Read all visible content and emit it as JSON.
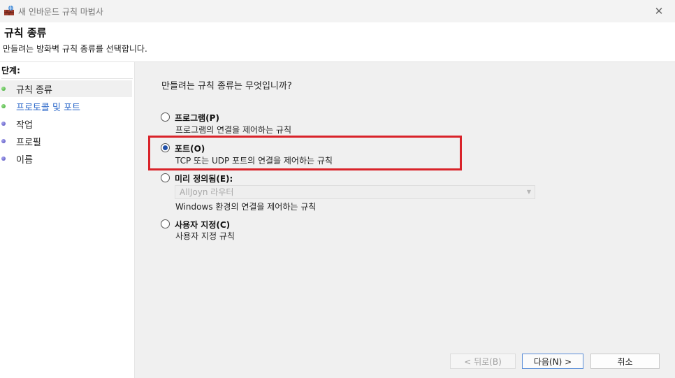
{
  "window": {
    "title": "새 인바운드 규칙 마법사",
    "close_glyph": "✕"
  },
  "header": {
    "title": "규칙 종류",
    "description": "만들려는 방화벽 규칙 종류를 선택합니다."
  },
  "sidebar": {
    "heading": "단계:",
    "steps": [
      {
        "label": "규칙 종류",
        "status": "completed-current"
      },
      {
        "label": "프로토콜 및 포트",
        "status": "completed-link"
      },
      {
        "label": "작업",
        "status": "pending"
      },
      {
        "label": "프로필",
        "status": "pending"
      },
      {
        "label": "이름",
        "status": "pending"
      }
    ]
  },
  "main": {
    "question": "만들려는 규칙 종류는 무엇입니까?",
    "options": [
      {
        "label": "프로그램(P)",
        "description": "프로그램의 연결을 제어하는 규칙",
        "checked": false
      },
      {
        "label": "포트(O)",
        "description": "TCP 또는 UDP 포트의 연결을 제어하는 규칙",
        "checked": true
      },
      {
        "label": "미리 정의됨(E):",
        "description": "Windows 환경의 연결을 제어하는 규칙",
        "checked": false
      },
      {
        "label": "사용자 지정(C)",
        "description": "사용자 지정 규칙",
        "checked": false
      }
    ],
    "predefined_select": {
      "value": "AllJoyn 라우터",
      "disabled": true
    }
  },
  "buttons": {
    "back": "< 뒤로(B)",
    "next": "다음(N) >",
    "cancel": "취소"
  },
  "colors": {
    "highlight": "#d9232a",
    "link": "#2a67c9",
    "step_done": "#3ba52f",
    "step_pending": "#4d49b8"
  },
  "icons": {
    "app": "firewall-wall-icon",
    "close": "close-icon"
  }
}
